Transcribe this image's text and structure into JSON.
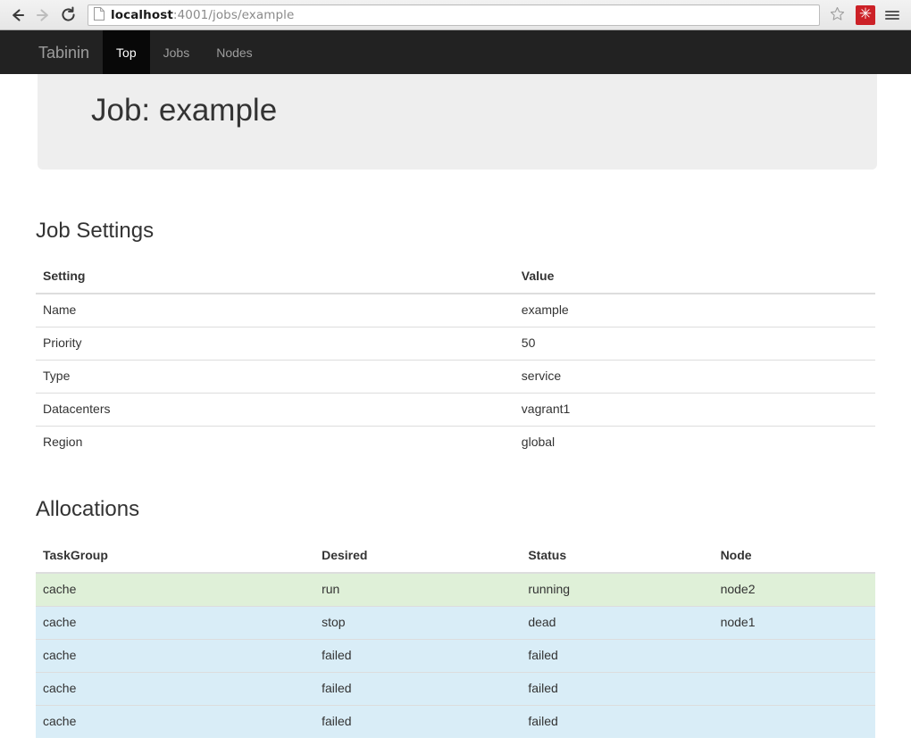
{
  "browser": {
    "back_icon": "back-arrow-icon",
    "forward_icon": "forward-arrow-icon",
    "reload_icon": "reload-icon",
    "page_icon": "page-document-icon",
    "url_host": "localhost",
    "url_rest": ":4001/jobs/example",
    "url_full": "localhost:4001/jobs/example",
    "bookmark_icon": "star-icon",
    "extension_icon": "extension-asterisk-icon",
    "extension_glyph": "✳",
    "extension_color": "#cc2127",
    "menu_icon": "hamburger-menu-icon"
  },
  "navbar": {
    "brand": "Tabinin",
    "background": "#222222",
    "active_background": "#080808",
    "items": [
      {
        "label": "Top",
        "active": true
      },
      {
        "label": "Jobs",
        "active": false
      },
      {
        "label": "Nodes",
        "active": false
      }
    ]
  },
  "jumbotron": {
    "title": "Job: example",
    "background": "#eeeeee"
  },
  "settings_section": {
    "title": "Job Settings",
    "columns": [
      "Setting",
      "Value"
    ],
    "rows": [
      {
        "setting": "Name",
        "value": "example"
      },
      {
        "setting": "Priority",
        "value": "50"
      },
      {
        "setting": "Type",
        "value": "service"
      },
      {
        "setting": "Datacenters",
        "value": "vagrant1"
      },
      {
        "setting": "Region",
        "value": "global"
      }
    ]
  },
  "allocations_section": {
    "title": "Allocations",
    "columns": [
      "TaskGroup",
      "Desired",
      "Status",
      "Node"
    ],
    "row_colors": {
      "success": "#dff0d8",
      "info": "#d9edf7"
    },
    "rows": [
      {
        "taskgroup": "cache",
        "desired": "run",
        "status": "running",
        "node": "node2",
        "state": "success"
      },
      {
        "taskgroup": "cache",
        "desired": "stop",
        "status": "dead",
        "node": "node1",
        "state": "info"
      },
      {
        "taskgroup": "cache",
        "desired": "failed",
        "status": "failed",
        "node": "",
        "state": "info"
      },
      {
        "taskgroup": "cache",
        "desired": "failed",
        "status": "failed",
        "node": "",
        "state": "info"
      },
      {
        "taskgroup": "cache",
        "desired": "failed",
        "status": "failed",
        "node": "",
        "state": "info"
      }
    ]
  }
}
